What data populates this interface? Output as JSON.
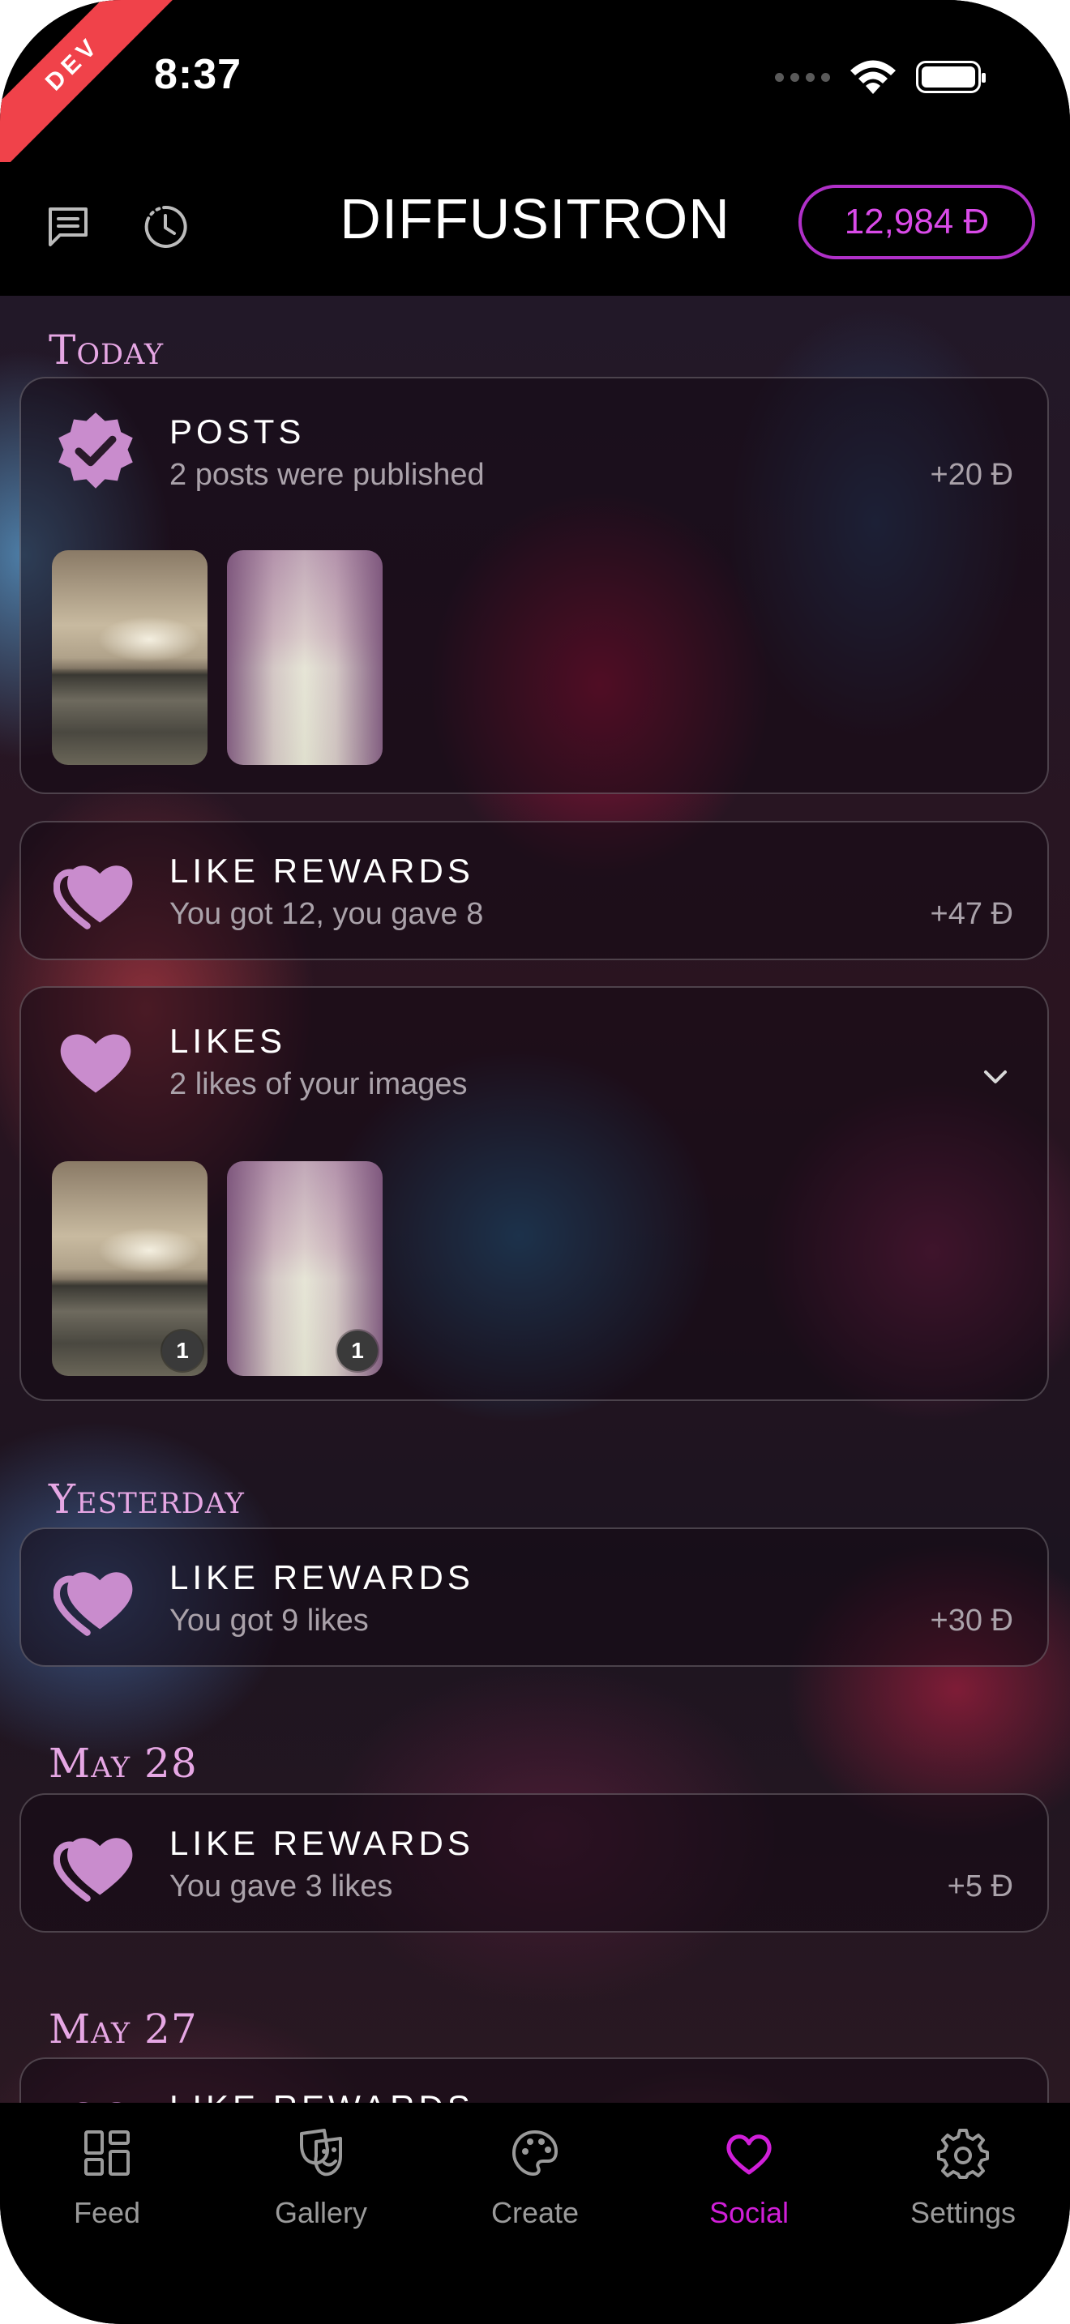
{
  "status_bar": {
    "time": "8:37",
    "dev_badge": "DEV"
  },
  "header": {
    "title": "DIFFUSITRON",
    "balance": "12,984 Ð",
    "left_icons": [
      "chat-icon",
      "history-icon"
    ]
  },
  "sections": [
    {
      "label": "Today",
      "cards": [
        {
          "icon": "verified-badge-icon",
          "title": "POSTS",
          "subtitle": "2 posts were published",
          "amount": "+20 Ð",
          "thumbnails": [
            "sea",
            "forest"
          ]
        },
        {
          "icon": "double-heart-icon",
          "title": "LIKE REWARDS",
          "subtitle": "You got 12, you gave 8",
          "amount": "+47 Ð"
        },
        {
          "icon": "heart-icon",
          "title": "LIKES",
          "subtitle": "2 likes of your images",
          "expand": "chevron-down-icon",
          "thumbnails": [
            {
              "img": "sea",
              "count": "1"
            },
            {
              "img": "forest",
              "count": "1"
            }
          ]
        }
      ]
    },
    {
      "label": "Yesterday",
      "cards": [
        {
          "icon": "double-heart-icon",
          "title": "LIKE REWARDS",
          "subtitle": "You got 9 likes",
          "amount": "+30 Ð"
        }
      ]
    },
    {
      "label": "May 28",
      "cards": [
        {
          "icon": "double-heart-icon",
          "title": "LIKE REWARDS",
          "subtitle": "You gave 3 likes",
          "amount": "+5 Ð"
        }
      ]
    },
    {
      "label": "May 27",
      "cards": [
        {
          "icon": "double-heart-icon",
          "title": "LIKE REWARDS"
        }
      ]
    }
  ],
  "tabbar": {
    "items": [
      {
        "label": "Feed",
        "icon": "feed-grid-icon"
      },
      {
        "label": "Gallery",
        "icon": "gallery-mask-icon"
      },
      {
        "label": "Create",
        "icon": "palette-icon"
      },
      {
        "label": "Social",
        "icon": "heart-outline-icon",
        "active": true
      },
      {
        "label": "Settings",
        "icon": "gear-icon"
      }
    ]
  },
  "colors": {
    "accent": "#d01fd8",
    "heart": "#c98ccd",
    "balance_border": "#b030c8",
    "label": "#e6a7e4",
    "dev_ribbon": "#f0424a"
  }
}
